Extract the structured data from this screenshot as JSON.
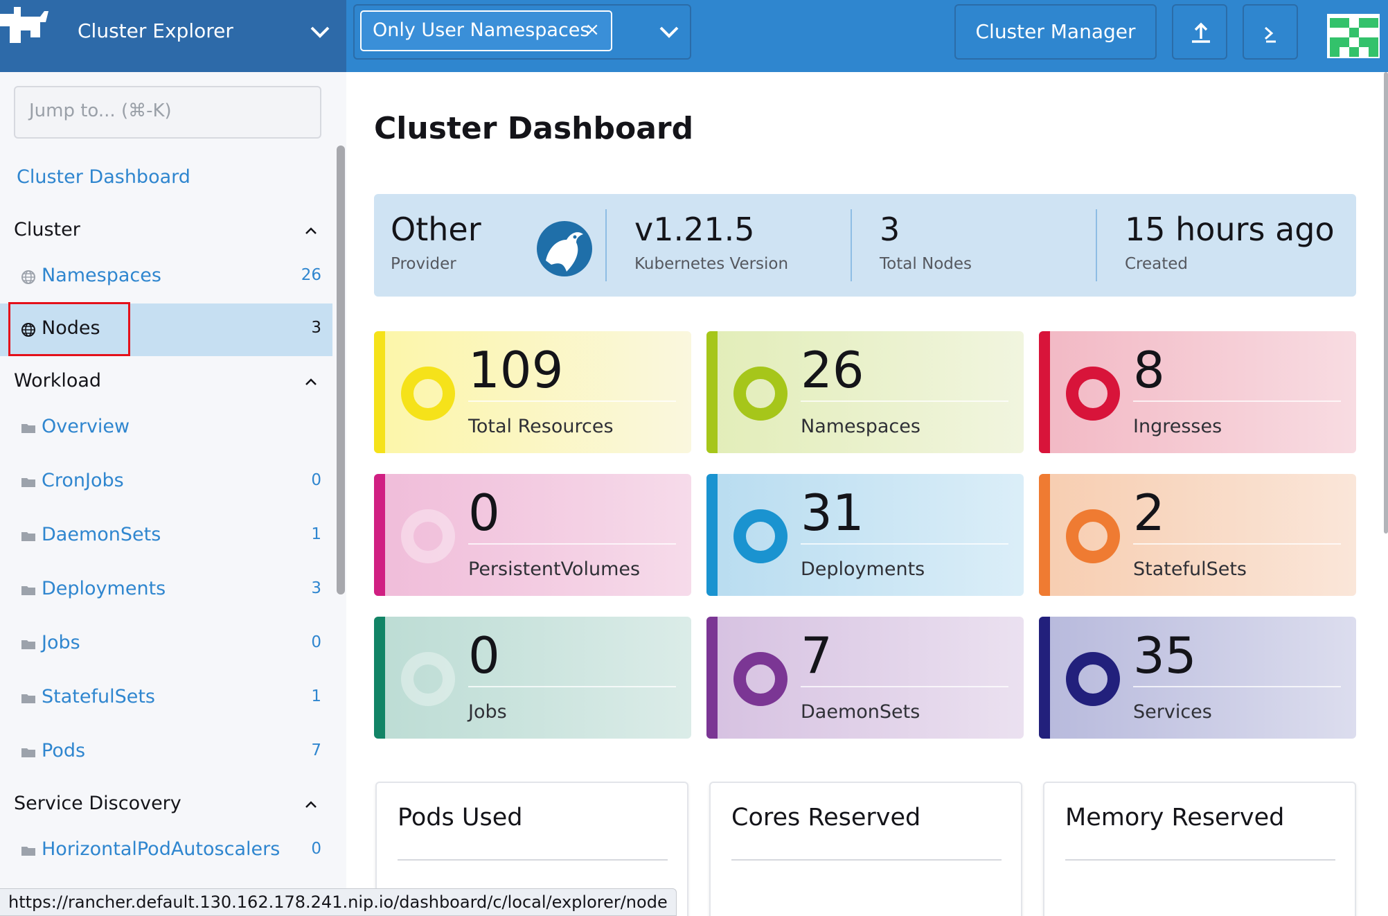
{
  "header": {
    "app_title": "Cluster Explorer",
    "namespace_filter": "Only User Namespaces",
    "namespace_filter_remove": "×",
    "cluster_manager_label": "Cluster Manager",
    "upload_icon": "upload-icon",
    "shell_icon": "kubectl-shell-icon"
  },
  "sidebar": {
    "search_placeholder": "Jump to... (⌘-K)",
    "dashboard_link": "Cluster Dashboard",
    "groups": [
      {
        "label": "Cluster",
        "expanded": true
      },
      {
        "label": "Workload",
        "expanded": true
      },
      {
        "label": "Service Discovery",
        "expanded": true
      }
    ],
    "items": [
      {
        "label": "Namespaces",
        "count": "26",
        "icon": "globe-icon",
        "active": false
      },
      {
        "label": "Nodes",
        "count": "3",
        "icon": "globe-icon",
        "active": true
      },
      {
        "label": "Overview",
        "count": "",
        "icon": "folder-icon",
        "active": false
      },
      {
        "label": "CronJobs",
        "count": "0",
        "icon": "folder-icon",
        "active": false
      },
      {
        "label": "DaemonSets",
        "count": "1",
        "icon": "folder-icon",
        "active": false
      },
      {
        "label": "Deployments",
        "count": "3",
        "icon": "folder-icon",
        "active": false
      },
      {
        "label": "Jobs",
        "count": "0",
        "icon": "folder-icon",
        "active": false
      },
      {
        "label": "StatefulSets",
        "count": "1",
        "icon": "folder-icon",
        "active": false
      },
      {
        "label": "Pods",
        "count": "7",
        "icon": "folder-icon",
        "active": false
      },
      {
        "label": "HorizontalPodAutoscalers",
        "count": "0",
        "icon": "folder-icon",
        "active": false
      }
    ]
  },
  "main": {
    "title": "Cluster Dashboard",
    "info": [
      {
        "value": "Other",
        "label": "Provider"
      },
      {
        "value": "v1.21.5",
        "label": "Kubernetes Version"
      },
      {
        "value": "3",
        "label": "Total Nodes"
      },
      {
        "value": "15 hours ago",
        "label": "Created"
      }
    ],
    "tiles": [
      {
        "value": "109",
        "label": "Total Resources",
        "color": "#f5e21a",
        "bg_from": "#fcf6a8",
        "bg_to": "#faf7de",
        "faded": false
      },
      {
        "value": "26",
        "label": "Namespaces",
        "color": "#a6c61a",
        "bg_from": "#e2edb8",
        "bg_to": "#f1f5df",
        "faded": false
      },
      {
        "value": "8",
        "label": "Ingresses",
        "color": "#d8143a",
        "bg_from": "#f2b8c4",
        "bg_to": "#f8dce2",
        "faded": false
      },
      {
        "value": "0",
        "label": "PersistentVolumes",
        "color": "#d01f82",
        "bg_from": "#f0bcd9",
        "bg_to": "#f6dbea",
        "faded": true
      },
      {
        "value": "31",
        "label": "Deployments",
        "color": "#1a93d0",
        "bg_from": "#b8dcf0",
        "bg_to": "#dbeef8",
        "faded": false
      },
      {
        "value": "2",
        "label": "StatefulSets",
        "color": "#ef7b32",
        "bg_from": "#f7cdb0",
        "bg_to": "#fae6d9",
        "faded": false
      },
      {
        "value": "0",
        "label": "Jobs",
        "color": "#128466",
        "bg_from": "#bcdcd4",
        "bg_to": "#dbece8",
        "faded": true
      },
      {
        "value": "7",
        "label": "DaemonSets",
        "color": "#7b3694",
        "bg_from": "#d6c1e1",
        "bg_to": "#ebe1f0",
        "faded": false
      },
      {
        "value": "35",
        "label": "Services",
        "color": "#22207c",
        "bg_from": "#b7b9dc",
        "bg_to": "#dcddee",
        "faded": false
      }
    ],
    "gauges": [
      {
        "title": "Pods Used"
      },
      {
        "title": "Cores Reserved"
      },
      {
        "title": "Memory Reserved"
      }
    ]
  },
  "status_bar": {
    "url": "https://rancher.default.130.162.178.241.nip.io/dashboard/c/local/explorer/node"
  }
}
